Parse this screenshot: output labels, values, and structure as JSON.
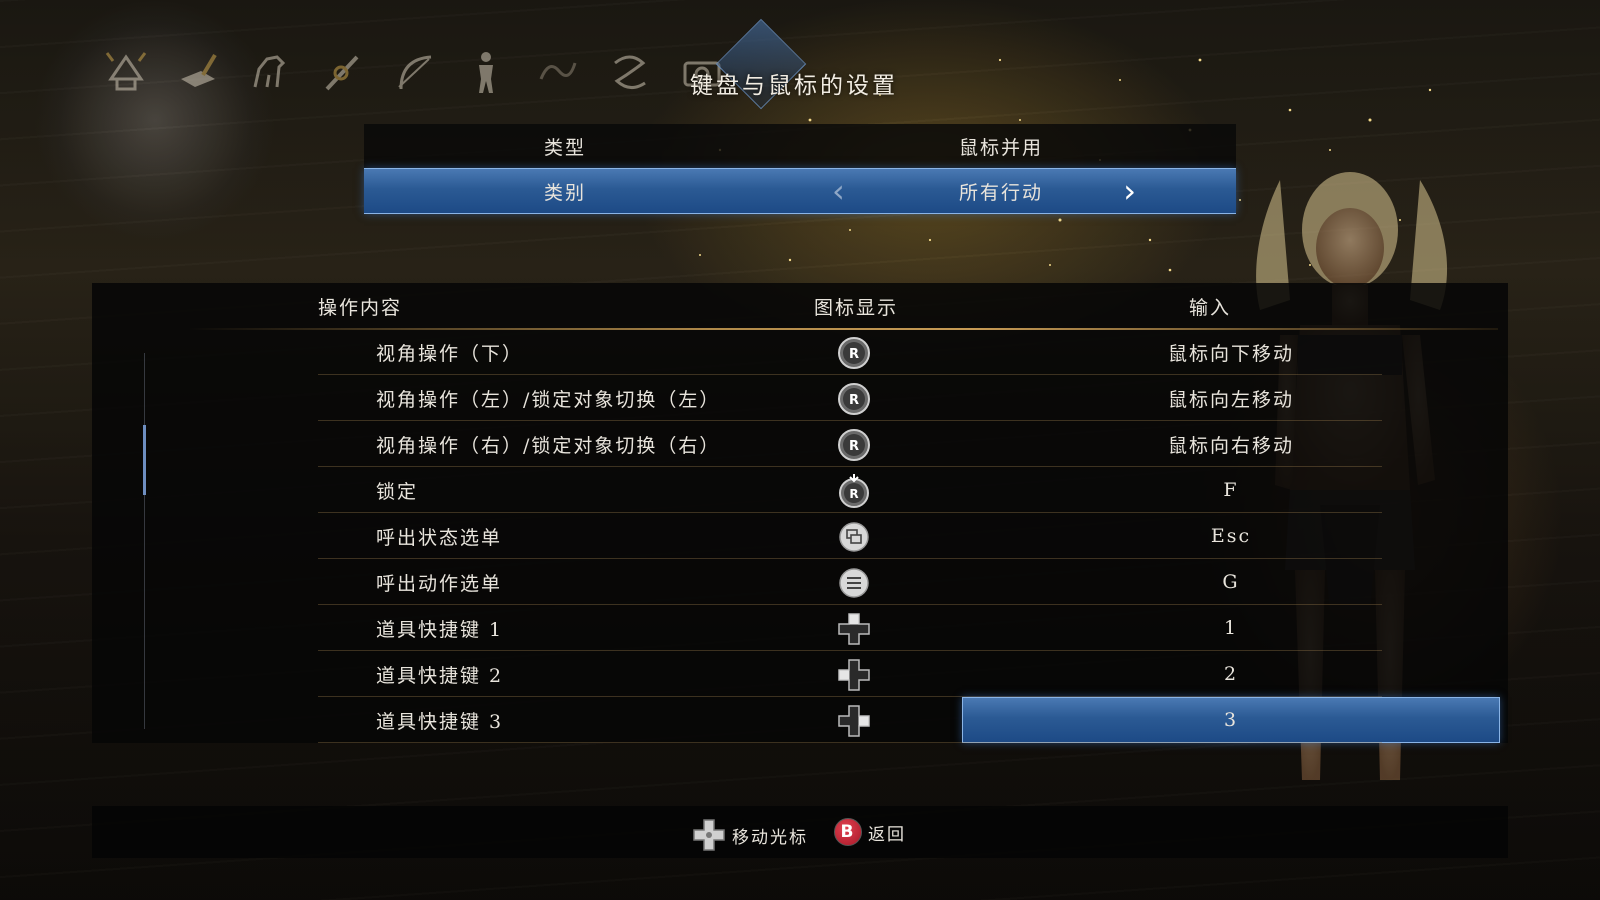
{
  "page": {
    "title": "键盘与鼠标的设置"
  },
  "icon_tabs": [
    {
      "icon": "samurai-helmet-icon"
    },
    {
      "icon": "scroll-brush-icon"
    },
    {
      "icon": "horse-icon"
    },
    {
      "icon": "sword-gear-icon"
    },
    {
      "icon": "bow-icon"
    },
    {
      "icon": "person-icon"
    },
    {
      "icon": "dragon-icon"
    },
    {
      "icon": "serpent-icon"
    },
    {
      "icon": "camera-icon"
    },
    {
      "icon": "gear-icon",
      "active": true
    }
  ],
  "settings": {
    "type_label": "类型",
    "type_value": "鼠标并用",
    "category_label": "类别",
    "category_value": "所有行动",
    "arrow_left": "‹",
    "arrow_right": "›"
  },
  "table": {
    "headers": {
      "action": "操作内容",
      "icon": "图标显示",
      "input": "输入"
    },
    "rows": [
      {
        "action": "视角操作（下）",
        "icon": "right-stick-icon",
        "input": "鼠标向下移动"
      },
      {
        "action": "视角操作（左）/锁定对象切换（左）",
        "icon": "right-stick-icon",
        "input": "鼠标向左移动"
      },
      {
        "action": "视角操作（右）/锁定对象切换（右）",
        "icon": "right-stick-icon",
        "input": "鼠标向右移动"
      },
      {
        "action": "锁定",
        "icon": "right-stick-press-icon",
        "input": "F"
      },
      {
        "action": "呼出状态选单",
        "icon": "view-button-icon",
        "input": "Esc"
      },
      {
        "action": "呼出动作选单",
        "icon": "menu-button-icon",
        "input": "G"
      },
      {
        "action": "道具快捷键 1",
        "icon": "dpad-up-icon",
        "input": "1"
      },
      {
        "action": "道具快捷键 2",
        "icon": "dpad-left-icon",
        "input": "2"
      },
      {
        "action": "道具快捷键 3",
        "icon": "dpad-right-icon",
        "input": "3",
        "selected": true
      }
    ]
  },
  "footer": {
    "move_label": "移动光标",
    "back_button": "B",
    "back_label": "返回"
  },
  "colors": {
    "highlight_blue": "#2b5a94",
    "highlight_border": "#8ab4e6",
    "gold_rule": "#c79b55",
    "back_button_red": "#c02030"
  }
}
